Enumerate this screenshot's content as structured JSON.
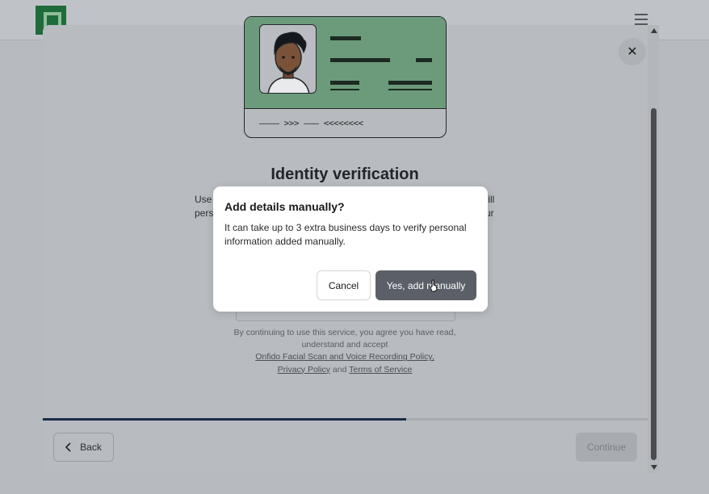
{
  "background": {
    "logo_icon": "brand-logo-icon",
    "menu_icon": "hamburger-menu-icon"
  },
  "modal": {
    "close_icon": "close-icon",
    "close_glyph": "✕",
    "illustration": {
      "name": "id-card-illustration",
      "mrz_text": "———— >>> ——— <<<<<<<<"
    },
    "title": "Identity verification",
    "description_fragments": {
      "line1_start": "Use",
      "line2_start": "pers",
      "line1_end": "fill",
      "line2_end": "ur"
    },
    "legal": {
      "line1": "By continuing to use this service, you agree you have read,",
      "line2": "understand and accept",
      "link1": "Onfido Facial Scan and Voice Recording Policy,",
      "link2": "Privacy Policy",
      "and_text": "and",
      "link3": "Terms of Service"
    },
    "progress": 0.6,
    "back_label": "Back",
    "continue_label": "Continue"
  },
  "dialog": {
    "title": "Add details manually?",
    "body": "It can take up to 3 extra business days to verify personal information added manually.",
    "cancel_label": "Cancel",
    "confirm_label": "Yes, add manually"
  },
  "colors": {
    "accent_green": "#6b9b7b",
    "confirm_button": "#5b6068",
    "progress_fill": "#1d2b4a"
  }
}
